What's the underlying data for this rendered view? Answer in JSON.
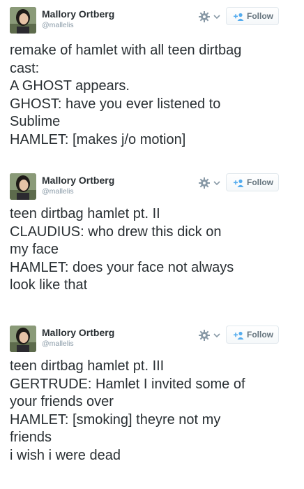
{
  "tweets": [
    {
      "author": {
        "name": "Mallory Ortberg",
        "handle": "@mallelis"
      },
      "follow_label": "Follow",
      "lines": [
        "remake of hamlet with all teen dirtbag",
        "cast:",
        "A GHOST appears.",
        "GHOST: have you ever listened to",
        "Sublime",
        "HAMLET: [makes j/o motion]"
      ]
    },
    {
      "author": {
        "name": "Mallory Ortberg",
        "handle": "@mallelis"
      },
      "follow_label": "Follow",
      "lines": [
        "teen dirtbag hamlet pt. II",
        "CLAUDIUS: who drew this dick on",
        "my face",
        "HAMLET: does your face not always",
        "look like that"
      ]
    },
    {
      "author": {
        "name": "Mallory Ortberg",
        "handle": "@mallelis"
      },
      "follow_label": "Follow",
      "lines": [
        "teen dirtbag hamlet pt. III",
        "GERTRUDE: Hamlet I invited some of",
        "your friends over",
        "HAMLET: [smoking] theyre not my",
        "friends",
        "i wish i were dead"
      ]
    }
  ],
  "icons": {
    "settings": "gear-icon",
    "menu": "chevron-down-icon",
    "follow": "add-user-icon",
    "avatar": "profile-photo"
  },
  "colors": {
    "text": "#292f33",
    "muted": "#8899a6",
    "follow_blue": "#55acee",
    "border": "#e1e8ed"
  }
}
